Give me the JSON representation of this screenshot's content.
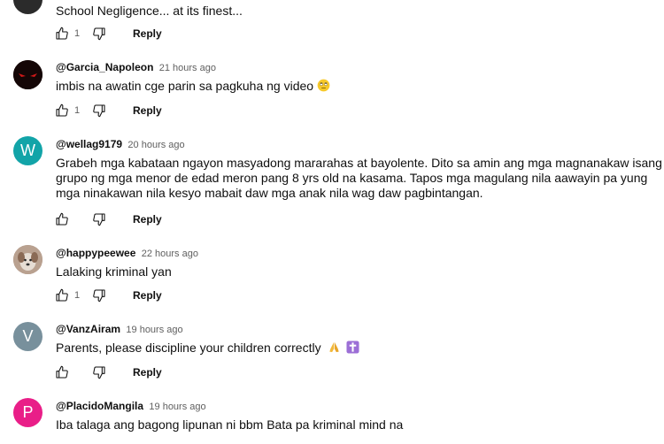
{
  "comments": [
    {
      "author": "",
      "time": "",
      "text": "School Negligence... at its finest...",
      "likes": "1",
      "avatar": {
        "letter": "",
        "color": "#2b2b2b"
      }
    },
    {
      "author": "@Garcia_Napoleon",
      "time": "21 hours ago",
      "text": "imbis na awatin cge parin sa pagkuha ng video",
      "likes": "1",
      "avatar": {
        "letter": "",
        "color": "#1a0a0a"
      }
    },
    {
      "author": "@wellag9179",
      "time": "20 hours ago",
      "text": "Grabeh mga kabataan ngayon masyadong mararahas at bayolente. Dito sa amin ang mga magnanakaw isang grupo ng mga menor de edad meron pang 8 yrs old na kasama. Tapos mga magulang nila aawayin pa yung mga ninakawan nila kesyo mabait daw mga anak nila wag daw pagbintangan.",
      "likes": "",
      "avatar": {
        "letter": "W",
        "color": "#12a4a8"
      }
    },
    {
      "author": "@happypeewee",
      "time": "22 hours ago",
      "text": "Lalaking kriminal yan",
      "likes": "1",
      "avatar": {
        "letter": "",
        "color": "#a88e7c"
      }
    },
    {
      "author": "@VanzAiram",
      "time": "19 hours ago",
      "text": "Parents, please discipline your children correctly",
      "likes": "",
      "avatar": {
        "letter": "V",
        "color": "#78909c"
      }
    },
    {
      "author": "@PlacidoMangila",
      "time": "19 hours ago",
      "text": "Iba talaga ang bagong lipunan ni bbm Bata pa kriminal mind na",
      "likes": "",
      "avatar": {
        "letter": "P",
        "color": "#e91e88"
      }
    }
  ],
  "reply_label": "Reply",
  "icons": {
    "like": "thumbs-up-icon",
    "dislike": "thumbs-down-icon",
    "emoji_face": "rolling-eyes-emoji",
    "emoji_pray": "praying-hands-emoji",
    "emoji_cross": "latin-cross-emoji"
  }
}
